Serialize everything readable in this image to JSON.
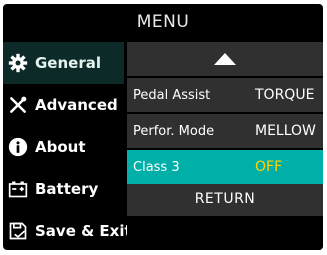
{
  "menu": {
    "title": "MENU"
  },
  "sidebar": {
    "items": [
      {
        "label": "General",
        "icon": "gear-icon"
      },
      {
        "label": "Advanced",
        "icon": "tools-icon"
      },
      {
        "label": "About",
        "icon": "info-icon"
      },
      {
        "label": "Battery",
        "icon": "battery-icon"
      },
      {
        "label": "Save & Exit",
        "icon": "save-exit-icon"
      }
    ]
  },
  "panel": {
    "scroll_up_icon": "triangle-up-icon",
    "rows": [
      {
        "label": "Pedal Assist",
        "value": "TORQUE"
      },
      {
        "label": "Perfor. Mode",
        "value": "MELLOW"
      },
      {
        "label": "Class 3",
        "value": "OFF"
      }
    ],
    "return_label": "RETURN"
  },
  "colors": {
    "background": "#000000",
    "panel": "#303030",
    "highlight": "#00b0a8",
    "value_highlight": "#ffd400",
    "sidebar_selected": "#0c2a28"
  }
}
